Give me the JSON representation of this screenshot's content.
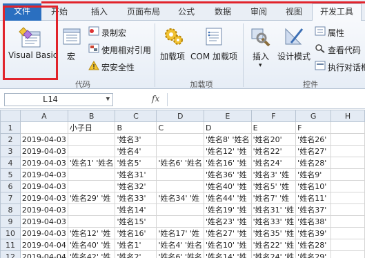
{
  "tabs": [
    {
      "label": "文件"
    },
    {
      "label": "开始"
    },
    {
      "label": "插入"
    },
    {
      "label": "页面布局"
    },
    {
      "label": "公式"
    },
    {
      "label": "数据"
    },
    {
      "label": "审阅"
    },
    {
      "label": "视图"
    },
    {
      "label": "开发工具"
    }
  ],
  "ribbon": {
    "code_group": {
      "label": "代码",
      "visual_basic": "Visual Basic",
      "macros": "宏",
      "record_macro": "录制宏",
      "relative_refs": "使用相对引用",
      "macro_security": "宏安全性"
    },
    "addins_group": {
      "label": "加载项",
      "addins": "加载项",
      "com_addins": "COM 加载项"
    },
    "controls_group": {
      "label": "控件",
      "insert": "插入",
      "design_mode": "设计模式",
      "properties": "属性",
      "view_code": "查看代码",
      "run_dialog": "执行对话框"
    }
  },
  "formula_bar": {
    "name_box": "L14",
    "fx": "fx",
    "formula": ""
  },
  "sheet": {
    "columns": [
      "A",
      "B",
      "C",
      "D",
      "E",
      "F",
      "G",
      "H"
    ],
    "rows": [
      {
        "n": "1",
        "cells": [
          "",
          "小子日",
          "B",
          "C",
          "D",
          "E",
          "F",
          ""
        ]
      },
      {
        "n": "2",
        "cells": [
          "2019-04-03",
          "",
          "'姓名3'",
          "",
          "'姓名8' '姓名",
          "'姓名20'",
          "'姓名26'",
          ""
        ]
      },
      {
        "n": "3",
        "cells": [
          "2019-04-03",
          "",
          "'姓名4'",
          "",
          "'姓名12' '姓",
          "'姓名22'",
          "'姓名27'",
          ""
        ]
      },
      {
        "n": "4",
        "cells": [
          "2019-04-03",
          "'姓名1' '姓名",
          "'姓名5'",
          "'姓名6' '姓名",
          "'姓名16' '姓",
          "'姓名24'",
          "'姓名28'",
          ""
        ]
      },
      {
        "n": "5",
        "cells": [
          "2019-04-03",
          "",
          "'姓名31'",
          "",
          "'姓名36' '姓",
          "'姓名3' '姓",
          "'姓名9'",
          ""
        ]
      },
      {
        "n": "6",
        "cells": [
          "2019-04-03",
          "",
          "'姓名32'",
          "",
          "'姓名40' '姓",
          "'姓名5' '姓",
          "'姓名10'",
          ""
        ]
      },
      {
        "n": "7",
        "cells": [
          "2019-04-03",
          "'姓名29' '姓",
          "'姓名33'",
          "'姓名34' '姓",
          "'姓名44' '姓",
          "'姓名7' '姓",
          "'姓名11'",
          ""
        ]
      },
      {
        "n": "8",
        "cells": [
          "2019-04-03",
          "",
          "'姓名14'",
          "",
          "'姓名19' '姓",
          "'姓名31' '姓",
          "'姓名37'",
          ""
        ]
      },
      {
        "n": "9",
        "cells": [
          "2019-04-03",
          "",
          "'姓名15'",
          "",
          "'姓名23' '姓",
          "'姓名33' '姓",
          "'姓名38'",
          ""
        ]
      },
      {
        "n": "10",
        "cells": [
          "2019-04-03",
          "'姓名12' '姓",
          "'姓名16'",
          "'姓名17' '姓",
          "'姓名27' '姓",
          "'姓名35' '姓",
          "'姓名39'",
          ""
        ]
      },
      {
        "n": "11",
        "cells": [
          "2019-04-04",
          "'姓名40' '姓",
          "'姓名1'",
          "'姓名4' '姓名",
          "'姓名10' '姓",
          "'姓名22' '姓",
          "'姓名28'",
          ""
        ]
      },
      {
        "n": "12",
        "cells": [
          "2019-04-04",
          "'姓名42' '姓",
          "'姓名2'",
          "'姓名6' '姓名",
          "'姓名14' '姓",
          "'姓名24' '姓",
          "'姓名29'",
          ""
        ]
      }
    ]
  }
}
